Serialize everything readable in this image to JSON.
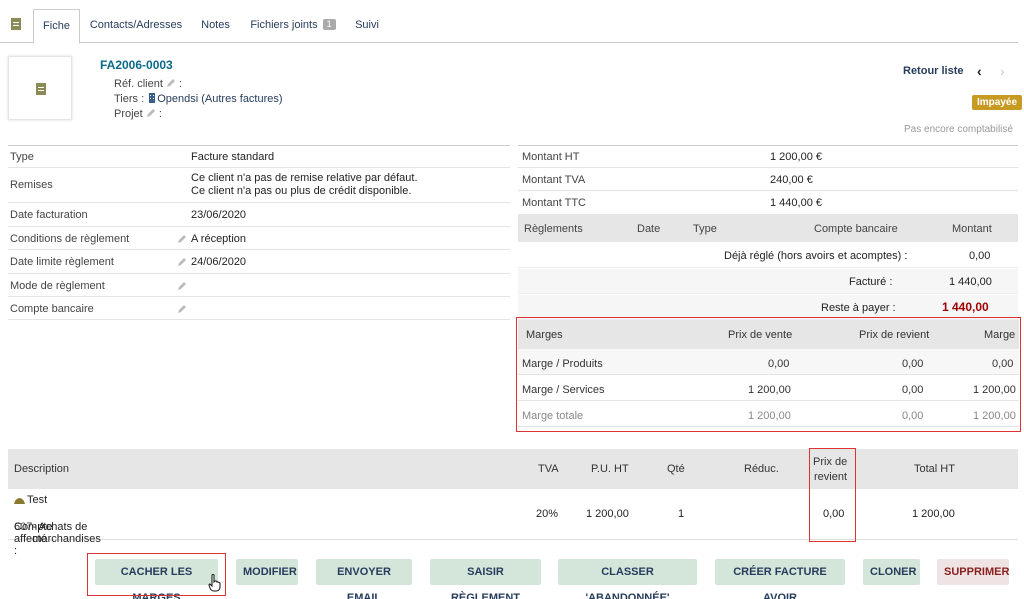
{
  "tabs": [
    {
      "label": "Fiche",
      "active": true
    },
    {
      "label": "Contacts/Adresses"
    },
    {
      "label": "Notes"
    },
    {
      "label": "Fichiers joints",
      "badge": "1"
    },
    {
      "label": "Suivi"
    }
  ],
  "header": {
    "ref": "FA2006-0003",
    "ref_client_label": "Réf. client",
    "tiers_label": "Tiers :",
    "tiers_value": "Opendsi (Autres factures)",
    "projet_label": "Projet",
    "retour": "Retour liste",
    "status": "Impayée",
    "compta": "Pas encore comptabilisé"
  },
  "info": {
    "type_label": "Type",
    "type_value": "Facture standard",
    "remises_label": "Remises",
    "remises_line1": "Ce client n'a pas de remise relative par défaut.",
    "remises_line2": "Ce client n'a pas ou plus de crédit disponible.",
    "date_label": "Date facturation",
    "date_value": "23/06/2020",
    "cond_label": "Conditions de règlement",
    "cond_value": "A réception",
    "limite_label": "Date limite règlement",
    "limite_value": "24/06/2020",
    "mode_label": "Mode de règlement",
    "compte_label": "Compte bancaire"
  },
  "amounts": {
    "ht_label": "Montant HT",
    "ht_value": "1 200,00 €",
    "tva_label": "Montant TVA",
    "tva_value": "240,00 €",
    "ttc_label": "Montant TTC",
    "ttc_value": "1 440,00 €"
  },
  "payments": {
    "headers": {
      "reglements": "Règlements",
      "date": "Date",
      "type": "Type",
      "compte": "Compte bancaire",
      "montant": "Montant"
    },
    "deja_label": "Déjà réglé (hors avoirs et acomptes) :",
    "deja_value": "0,00",
    "facture_label": "Facturé :",
    "facture_value": "1 440,00",
    "reste_label": "Reste à payer :",
    "reste_value": "1 440,00"
  },
  "margins": {
    "headers": {
      "marges": "Marges",
      "vente": "Prix de vente",
      "revient": "Prix de revient",
      "marge": "Marge"
    },
    "rows": [
      {
        "label": "Marge / Produits",
        "vente": "0,00",
        "revient": "0,00",
        "marge": "0,00"
      },
      {
        "label": "Marge / Services",
        "vente": "1 200,00",
        "revient": "0,00",
        "marge": "1 200,00"
      },
      {
        "label": "Marge totale",
        "vente": "1 200,00",
        "revient": "0,00",
        "marge": "1 200,00"
      }
    ]
  },
  "lines": {
    "headers": {
      "description": "Description",
      "tva": "TVA",
      "pu": "P.U. HT",
      "qte": "Qté",
      "reduc": "Réduc.",
      "prix_revient_1": "Prix de",
      "prix_revient_2": "revient",
      "total": "Total HT"
    },
    "row": {
      "desc": "Test",
      "compte_label": "Compte affecté :",
      "compte_num": "607",
      "compte_name": "- Achats de marchandises",
      "tva": "20%",
      "pu": "1 200,00",
      "qte": "1",
      "prix_revient": "0,00",
      "total": "1 200,00"
    }
  },
  "buttons": {
    "cacher": "CACHER LES MARGES",
    "modifier": "MODIFIER",
    "email": "ENVOYER EMAIL",
    "reglement": "SAISIR RÈGLEMENT",
    "abandonnee": "CLASSER 'ABANDONNÉE'",
    "avoir": "CRÉER FACTURE AVOIR",
    "cloner": "CLONER",
    "supprimer": "SUPPRIMER"
  },
  "colors": {
    "link": "#263c5c",
    "ref": "#0b6b8a",
    "status": "#c79a24",
    "due": "#a00000",
    "button": "#d4e6da",
    "highlight": "#dd3333"
  }
}
